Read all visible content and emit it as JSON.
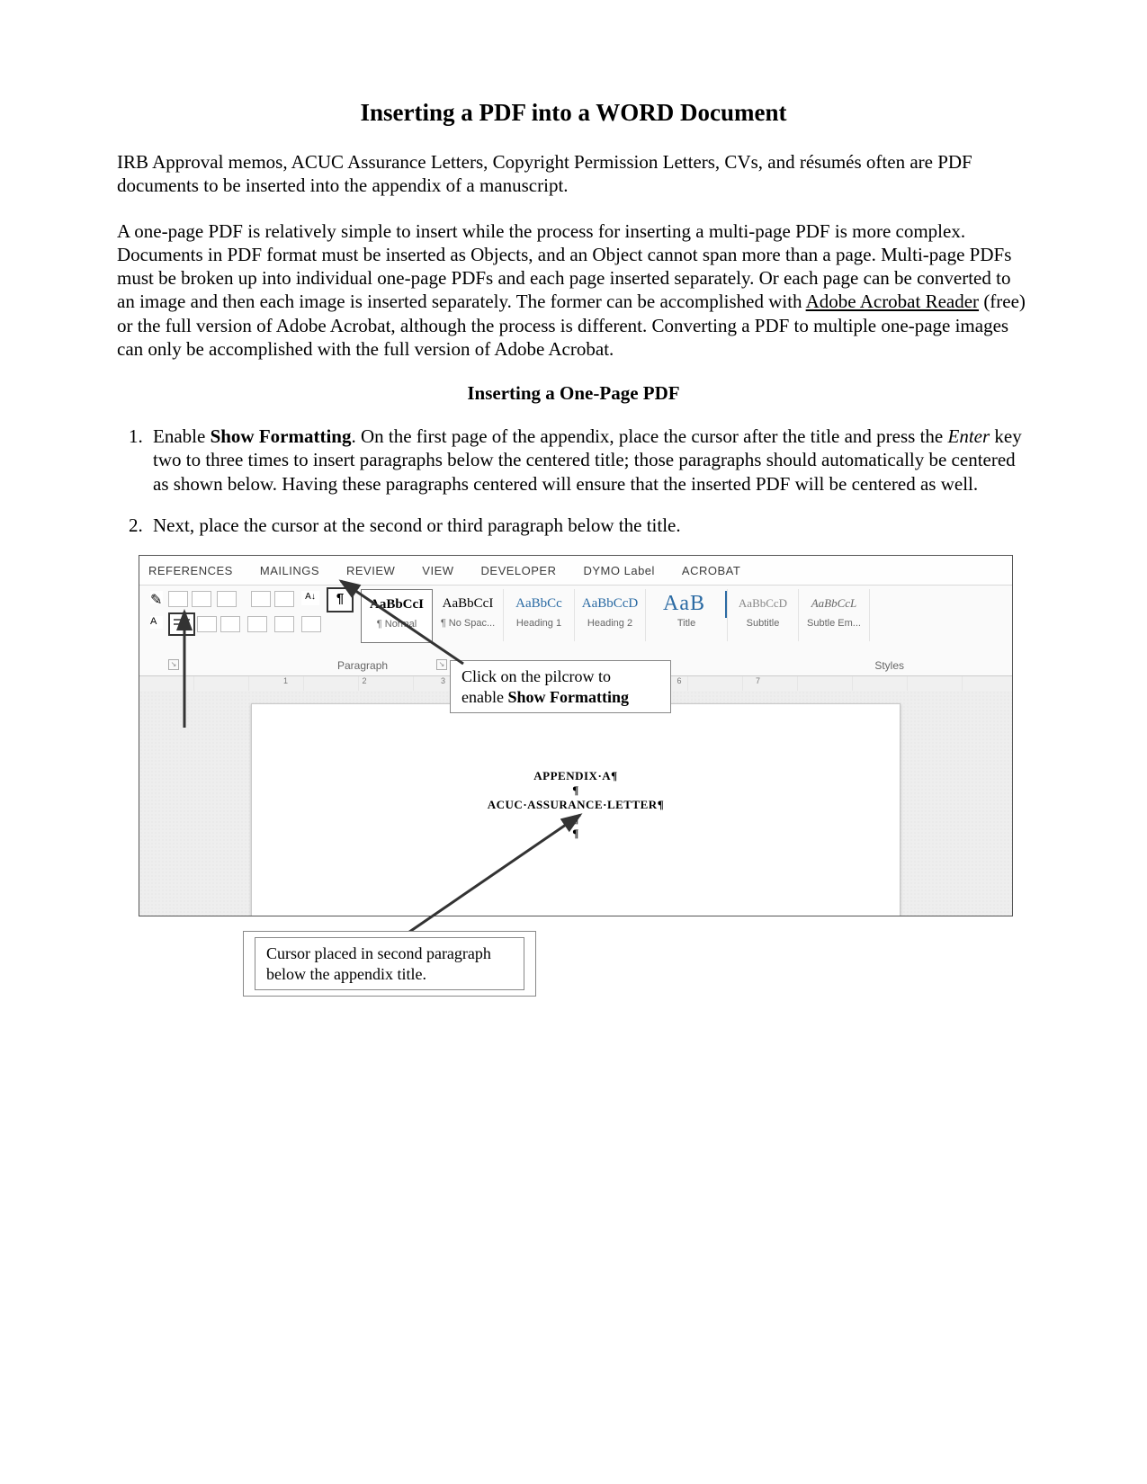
{
  "title": "Inserting a PDF into a WORD Document",
  "intro1": "IRB Approval memos, ACUC Assurance Letters, Copyright Permission Letters, CVs, and résumés often are PDF documents to be inserted into the appendix of a manuscript.",
  "intro2_a": "A one-page PDF is relatively simple to insert while the process for inserting a multi-page PDF is more complex. Documents in PDF format must be inserted as Objects, and an Object cannot span more than a page. Multi-page PDFs must be broken up into individual one-page PDFs and each page inserted separately. Or each page can be converted to an image and then each image is inserted separately. The former can be accomplished with ",
  "intro2_link": "Adobe Acrobat Reader",
  "intro2_b": " (free) or the full version of Adobe Acrobat, although the process is different. Converting a PDF to multiple one-page images can only be accomplished with the full version of Adobe Acrobat.",
  "section1_title": "Inserting a One-Page PDF",
  "step1_a": "Enable ",
  "step1_b": "Show Formatting",
  "step1_c": ". On the first page of the appendix, place the cursor after the title and press the ",
  "step1_d": "Enter",
  "step1_e": " key two to three times to insert paragraphs below the centered title; those paragraphs should automatically be centered as shown below. Having these paragraphs centered will ensure that the inserted PDF will be centered as well.",
  "step2": "Next, place the cursor at the second or third paragraph below the title.",
  "ribbon": {
    "tabs": [
      "REFERENCES",
      "MAILINGS",
      "REVIEW",
      "VIEW",
      "DEVELOPER",
      "DYMO Label",
      "ACROBAT"
    ],
    "groups": {
      "clipboard": "",
      "paragraph": "Paragraph",
      "styles": "Styles"
    },
    "pilcrow": "¶",
    "sort": "A↓",
    "font_a": "A",
    "styles": [
      {
        "preview": "AaBbCcI",
        "label": "¶ Normal",
        "cls": "normal",
        "pcls": "p1"
      },
      {
        "preview": "AaBbCcI",
        "label": "¶ No Spac...",
        "pcls": "p1"
      },
      {
        "preview": "AaBbCc",
        "label": "Heading 1",
        "pcls": "pH"
      },
      {
        "preview": "AaBbCcD",
        "label": "Heading 2",
        "pcls": "pH"
      },
      {
        "preview": "AaB",
        "label": "Title",
        "pcls": "pT"
      },
      {
        "preview": "AaBbCcD",
        "label": "Subtitle",
        "pcls": "pS"
      },
      {
        "preview": "AaBbCcL",
        "label": "Subtle Em...",
        "pcls": "pE"
      }
    ],
    "ruler_marks": "1 2 3 4 5 6 7"
  },
  "doc_page": {
    "line1": "APPENDIX·A¶",
    "line2": "¶",
    "line3": "ACUC·ASSURANCE·LETTER¶",
    "line4": "¶",
    "line5": "¶"
  },
  "callout_a_1": "Click on the pilcrow to",
  "callout_a_2a": "enable ",
  "callout_a_2b": "Show Formatting",
  "callout_b": "Cursor placed in second paragraph below the appendix title."
}
